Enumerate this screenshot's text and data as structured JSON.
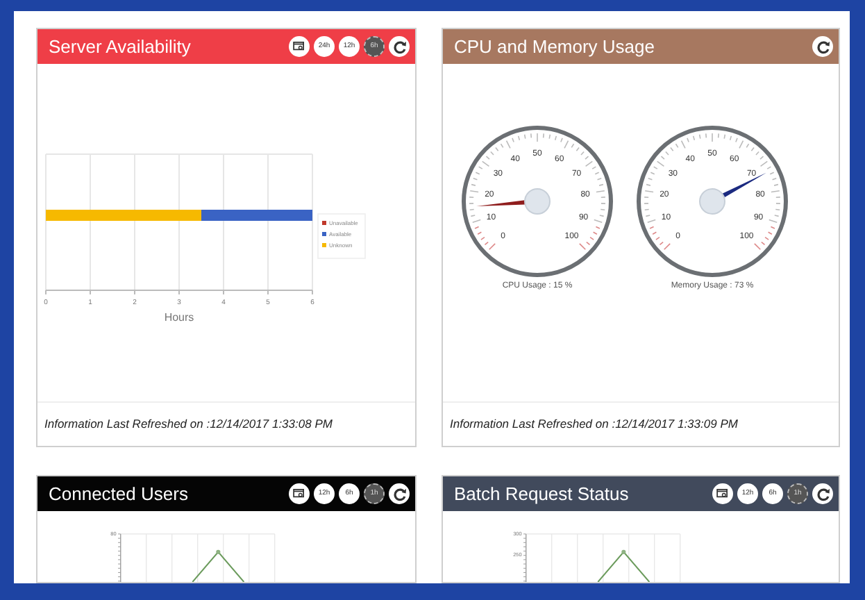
{
  "panels": [
    {
      "title": "Server Availability",
      "color": "#ef3e47",
      "buttons": [
        {
          "kind": "view"
        },
        {
          "kind": "range",
          "label": "24h",
          "selected": false
        },
        {
          "kind": "range",
          "label": "12h",
          "selected": false
        },
        {
          "kind": "range",
          "label": "6h",
          "selected": true
        },
        {
          "kind": "refresh"
        }
      ],
      "body": {
        "kind": "bar_chart",
        "chart_data": {
          "type": "bar",
          "orientation": "horizontal",
          "stacked": true,
          "xlabel": "Hours",
          "xlim": [
            0,
            6
          ],
          "xticks": [
            0,
            1,
            2,
            3,
            4,
            5,
            6
          ],
          "grid": true,
          "legend": true,
          "series": [
            {
              "name": "Unavailable",
              "color": "#c0392b",
              "values": [
                0
              ]
            },
            {
              "name": "Available",
              "color": "#3a63c4",
              "values": [
                2.5
              ]
            },
            {
              "name": "Unknown",
              "color": "#f6b900",
              "values": [
                3.5
              ]
            }
          ]
        }
      },
      "footer": "Information Last Refreshed on :12/14/2017 1:33:08 PM"
    },
    {
      "title": "CPU and Memory Usage",
      "color": "#a77860",
      "buttons": [
        {
          "kind": "refresh"
        }
      ],
      "body": {
        "kind": "gauges",
        "gauges": [
          {
            "label": "CPU Usage : 15 %",
            "level": 0.15,
            "color": "#8f1d1d",
            "ticks": [
              "0",
              "10",
              "20",
              "30",
              "40",
              "50",
              "60",
              "70",
              "80",
              "90",
              "100"
            ]
          },
          {
            "label": "Memory Usage : 73 %",
            "level": 0.73,
            "color": "#1b2a80",
            "ticks": [
              "0",
              "10",
              "20",
              "30",
              "40",
              "50",
              "60",
              "70",
              "80",
              "90",
              "100"
            ]
          }
        ]
      },
      "footer": "Information Last Refreshed on :12/14/2017 1:33:09 PM"
    },
    {
      "title": "Connected Users",
      "color": "#050505",
      "buttons": [
        {
          "kind": "view"
        },
        {
          "kind": "range",
          "label": "12h",
          "selected": false
        },
        {
          "kind": "range",
          "label": "6h",
          "selected": false
        },
        {
          "kind": "range",
          "label": "1h",
          "selected": true
        },
        {
          "kind": "refresh"
        }
      ],
      "body": {
        "kind": "line_chart",
        "y_tick_labels": [
          "80"
        ]
      }
    },
    {
      "title": "Batch Request Status",
      "color": "#414a5c",
      "buttons": [
        {
          "kind": "view"
        },
        {
          "kind": "range",
          "label": "12h",
          "selected": false
        },
        {
          "kind": "range",
          "label": "6h",
          "selected": false
        },
        {
          "kind": "range",
          "label": "1h",
          "selected": true
        },
        {
          "kind": "refresh"
        }
      ],
      "body": {
        "kind": "line_chart",
        "y_tick_labels": [
          "300",
          "250"
        ]
      }
    }
  ]
}
